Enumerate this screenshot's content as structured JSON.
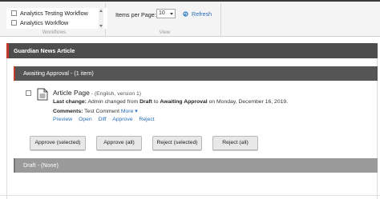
{
  "ribbon": {
    "workflows": {
      "items": [
        "Analytics Testing Workflow",
        "Analytics Workflow"
      ],
      "group_label": "Workflows"
    },
    "view": {
      "items_per_page_label": "Items per Page:",
      "items_per_page_value": "10",
      "refresh_label": "Refresh",
      "group_label": "View"
    }
  },
  "page": {
    "title": "Guardian News Article"
  },
  "sections": {
    "awaiting": "Awaiting Approval - (1 item)",
    "draft": "Draft - (None)"
  },
  "item": {
    "name": "Article Page",
    "meta": " - (English, version 1)",
    "last_change_label": "Last change:",
    "last_change_text_1": " Admin changed from ",
    "from_state": "Draft",
    "last_change_text_2": " to ",
    "to_state": "Awaiting Approval",
    "last_change_text_3": " on Monday, December 16, 2019.",
    "comments_label": "Comments:",
    "comments_text": " Test Comment ",
    "more_label": "More ▾",
    "actions": [
      "Preview",
      "Open",
      "Diff",
      "Approve",
      "Reject"
    ]
  },
  "buttons": {
    "approve_selected": "Approve (selected)",
    "approve_all": "Approve (all)",
    "reject_selected": "Reject (selected)",
    "reject_all": "Reject (all)"
  },
  "colors": {
    "accent_red": "#c0392b",
    "link_blue": "#2a6ebb",
    "header_dark": "#4d4d4d"
  }
}
